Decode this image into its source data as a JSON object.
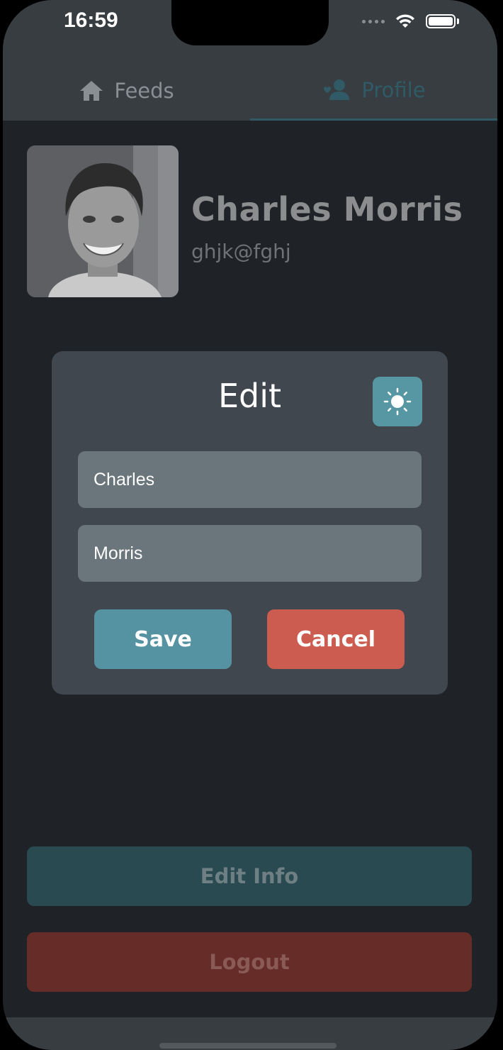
{
  "status_bar": {
    "time": "16:59",
    "icons": [
      "signal-dots-icon",
      "wifi-icon",
      "battery-icon"
    ]
  },
  "tabs": [
    {
      "label": "Feeds",
      "icon": "home-icon",
      "active": false
    },
    {
      "label": "Profile",
      "icon": "user-icon",
      "active": true
    }
  ],
  "profile": {
    "name": "Charles Morris",
    "email": "ghjk@fghj"
  },
  "edit_dialog": {
    "title": "Edit",
    "theme_icon": "sun-icon",
    "first_name_value": "Charles",
    "last_name_value": "Morris",
    "save_label": "Save",
    "cancel_label": "Cancel"
  },
  "actions": {
    "edit_info_label": "Edit Info",
    "logout_label": "Logout"
  },
  "colors": {
    "accent": "#5693a2",
    "danger": "#cc5c50",
    "background": "#1f2327",
    "surface": "#41474e"
  }
}
